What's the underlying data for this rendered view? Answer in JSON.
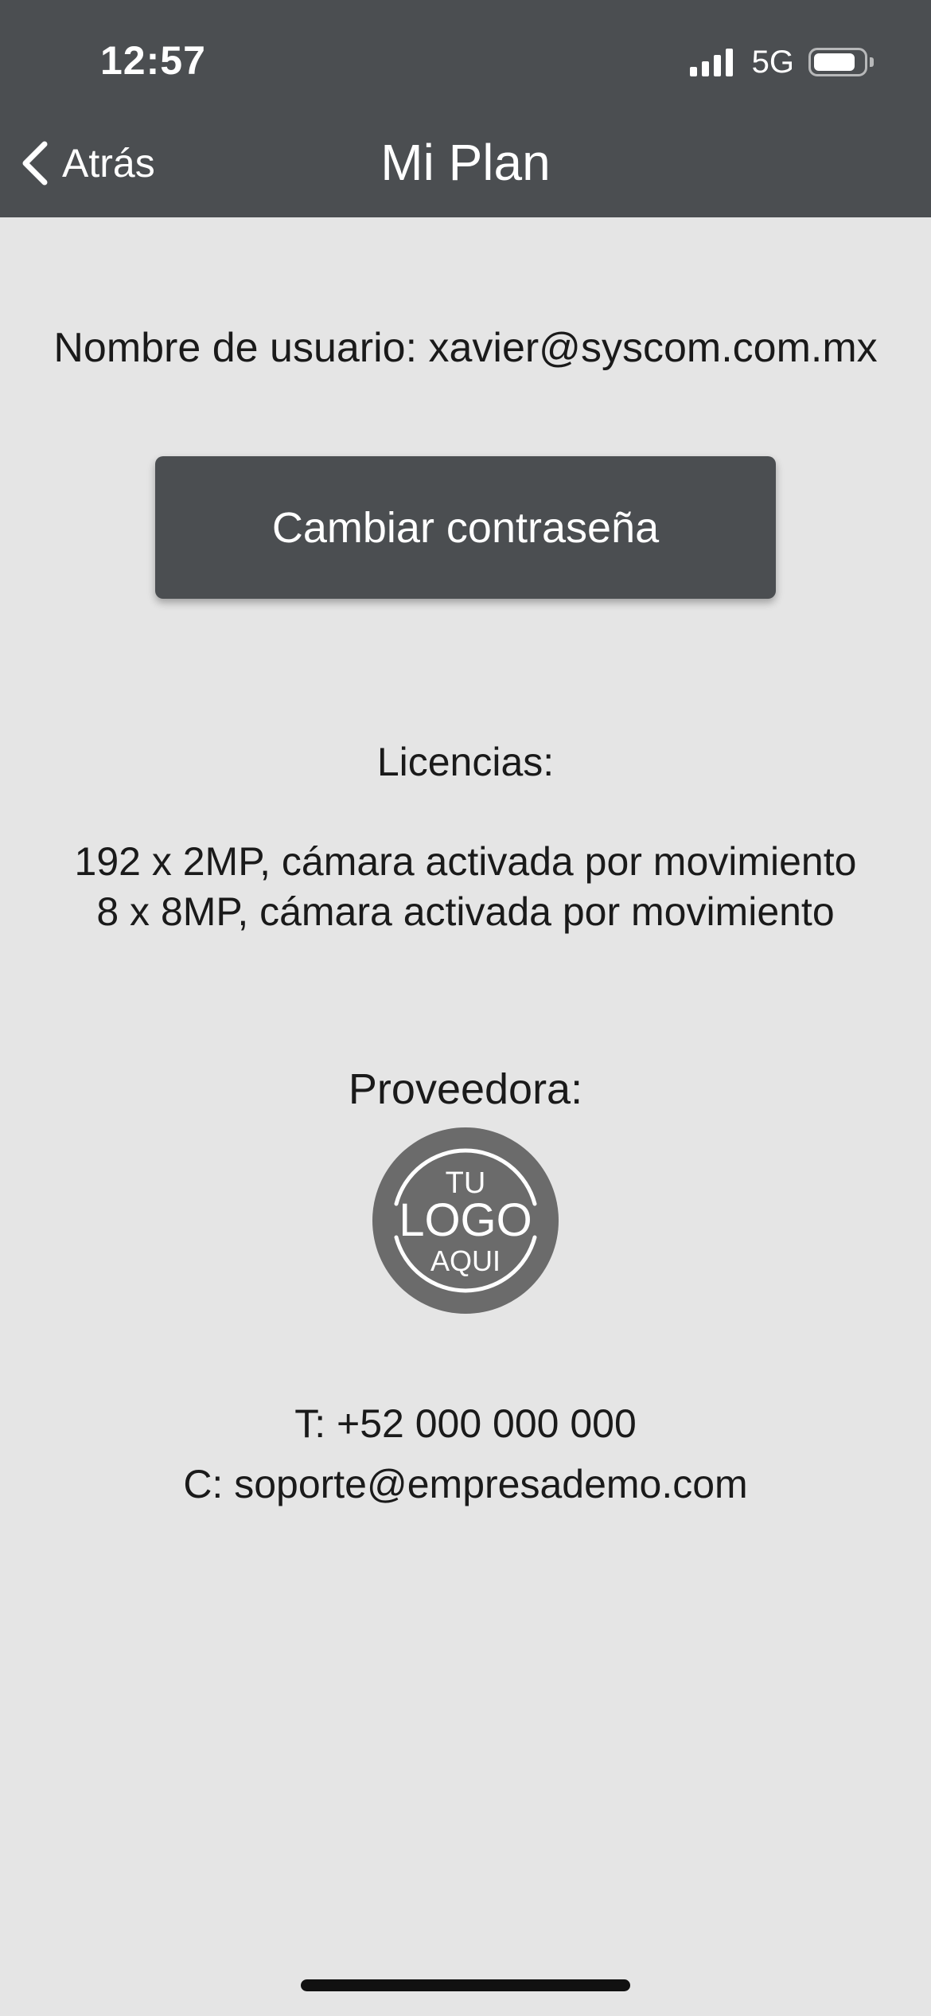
{
  "status_bar": {
    "time": "12:57",
    "network": "5G",
    "battery_level": 0.85,
    "signal_bars": 4
  },
  "nav": {
    "back_label": "Atrás",
    "title": "Mi Plan"
  },
  "account": {
    "username_text": "Nombre de usuario: xavier@syscom.com.mx",
    "change_password_label": "Cambiar contraseña"
  },
  "licenses": {
    "title": "Licencias:",
    "items": [
      "192 x 2MP, cámara activada por movimiento",
      "8 x 8MP, cámara activada por movimiento"
    ]
  },
  "provider": {
    "title": "Proveedora:",
    "logo": {
      "line_top": "TU",
      "line_middle": "LOGO",
      "line_bottom": "AQUI",
      "color": "#6b6b6b"
    },
    "phone": "T: +52 000 000 000",
    "email": "C: soporte@empresademo.com"
  },
  "colors": {
    "header_bg": "#4b4e51",
    "page_bg": "#e5e5e5",
    "button_bg": "#4b4e51",
    "text": "#1a1a1a"
  }
}
